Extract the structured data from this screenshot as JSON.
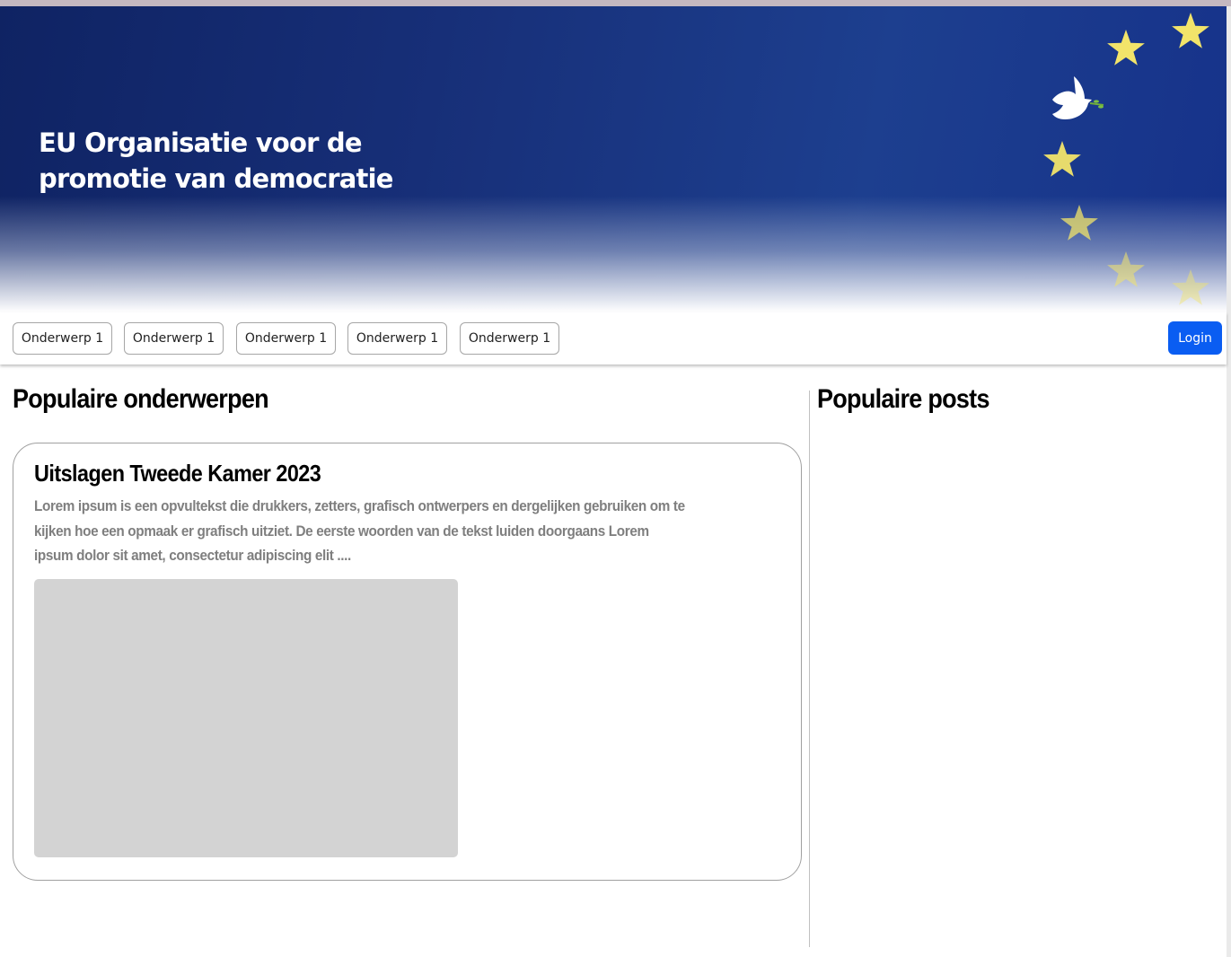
{
  "header": {
    "title": "EU Organisatie voor de promotie van democratie",
    "decoration_icons": [
      "star-icon",
      "dove-icon"
    ],
    "colors": {
      "navy": "#172f78",
      "star": "#f2e46a"
    }
  },
  "nav": {
    "topics": [
      "Onderwerp 1",
      "Onderwerp 1",
      "Onderwerp 1",
      "Onderwerp 1",
      "Onderwerp 1"
    ],
    "login_label": "Login",
    "login_color": "#0a5df2"
  },
  "main": {
    "popular_topics_heading": "Populaire onderwerpen",
    "card": {
      "title": "Uitslagen Tweede Kamer 2023",
      "text": "Lorem ipsum is een opvultekst die drukkers, zetters, grafisch ontwerpers en dergelijken gebruiken om te kijken hoe een opmaak er grafisch uitziet. De eerste woorden van de tekst luiden doorgaans Lorem ipsum dolor sit amet, consectetur adipiscing elit ...."
    }
  },
  "sidebar": {
    "popular_posts_heading": "Populaire posts"
  }
}
